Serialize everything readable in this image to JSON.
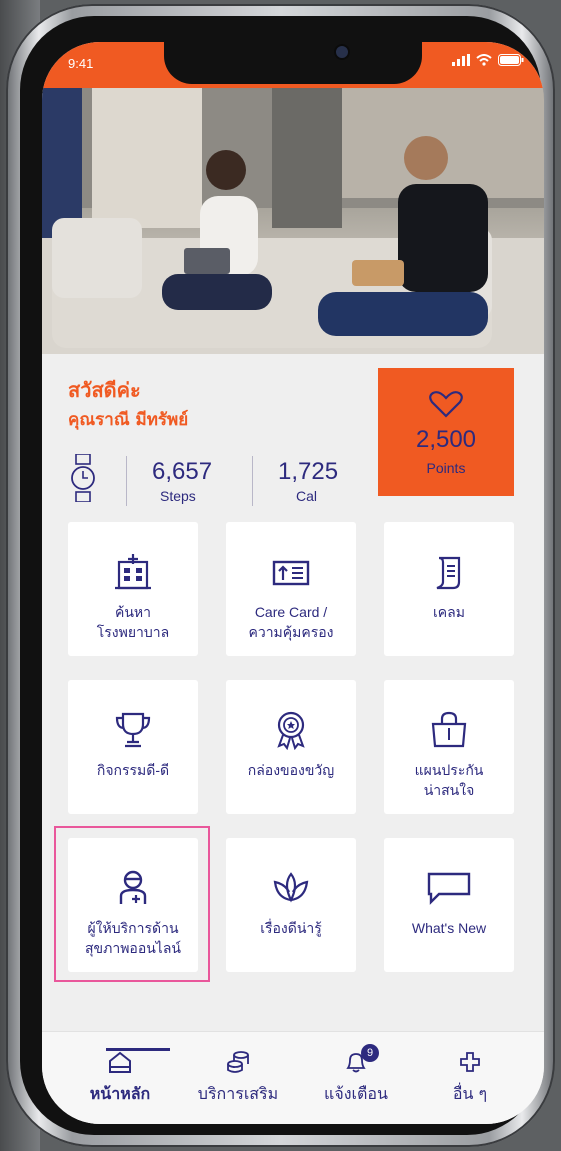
{
  "status_bar": {
    "time": "9:41"
  },
  "greeting": {
    "hello": "สวัสดีค่ะ",
    "name": "คุณราณี มีทรัพย์"
  },
  "stats": {
    "steps_value": "6,657",
    "steps_label": "Steps",
    "cal_value": "1,725",
    "cal_label": "Cal"
  },
  "points": {
    "value": "2,500",
    "label": "Points"
  },
  "tiles": [
    {
      "label": "ค้นหา\nโรงพยาบาล",
      "icon": "hospital-icon"
    },
    {
      "label": "Care Card /\nความคุ้มครอง",
      "icon": "card-icon"
    },
    {
      "label": "เคลม",
      "icon": "document-icon"
    },
    {
      "label": "กิจกรรมดี-ดี",
      "icon": "trophy-icon"
    },
    {
      "label": "กล่องของขวัญ",
      "icon": "award-icon"
    },
    {
      "label": "แผนประกัน\nน่าสนใจ",
      "icon": "shopping-bag-icon"
    },
    {
      "label": "ผู้ให้บริการด้าน\nสุขภาพออนไลน์",
      "icon": "doctor-icon"
    },
    {
      "label": "เรื่องดีน่ารู้",
      "icon": "lotus-icon"
    },
    {
      "label": "What's New",
      "icon": "chat-bubble-icon"
    }
  ],
  "tabbar": {
    "home": "หน้าหลัก",
    "services": "บริการเสริม",
    "notifications": "แจ้งเตือน",
    "notification_count": "9",
    "more": "อื่น ๆ"
  },
  "colors": {
    "brand": "#f05a22",
    "text": "#2d2a7e",
    "highlight": "#e9579b"
  }
}
